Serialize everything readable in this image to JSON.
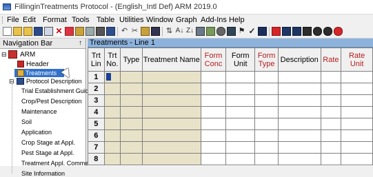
{
  "window": {
    "title": "FillinginTreatments Protocol - (English_Intl Def) ARM 2019.0"
  },
  "menu": [
    "File",
    "Edit",
    "Format",
    "Tools",
    "Table",
    "Utilities",
    "Window",
    "Graph",
    "Add-Ins",
    "Help"
  ],
  "nav": {
    "header": "Navigation Bar",
    "pin": "↑",
    "root": "ARM",
    "header_item": "Header",
    "treatments": "Treatments",
    "protocol_desc": "Protocol Description",
    "children": [
      "Trial Establishment Guid>",
      "Crop/Pest Description",
      "Maintenance",
      "Soil",
      "Application",
      "Crop Stage at Appl.",
      "Pest Stage at Appl.",
      "Treatment Appl. Comments",
      "Site Information"
    ]
  },
  "grid": {
    "title": "Treatments - Line 1",
    "headers": {
      "trt_lin": "Trt Lin",
      "trt_no": "Trt No.",
      "type": "Type",
      "treatment_name": "Treatment Name",
      "form_conc": "Form Conc",
      "form_unit": "Form Unit",
      "form_type": "Form Type",
      "description": "Description",
      "rate": "Rate",
      "rate_unit": "Rate Unit"
    },
    "rows": [
      "1",
      "2",
      "3",
      "4",
      "5",
      "6",
      "7",
      "8"
    ]
  },
  "colors": {
    "header_red": "#b71c1c",
    "grid_title_bg": "#8db3dd",
    "tan_cells": "#e8e2c8",
    "selection": "#3271c8"
  }
}
